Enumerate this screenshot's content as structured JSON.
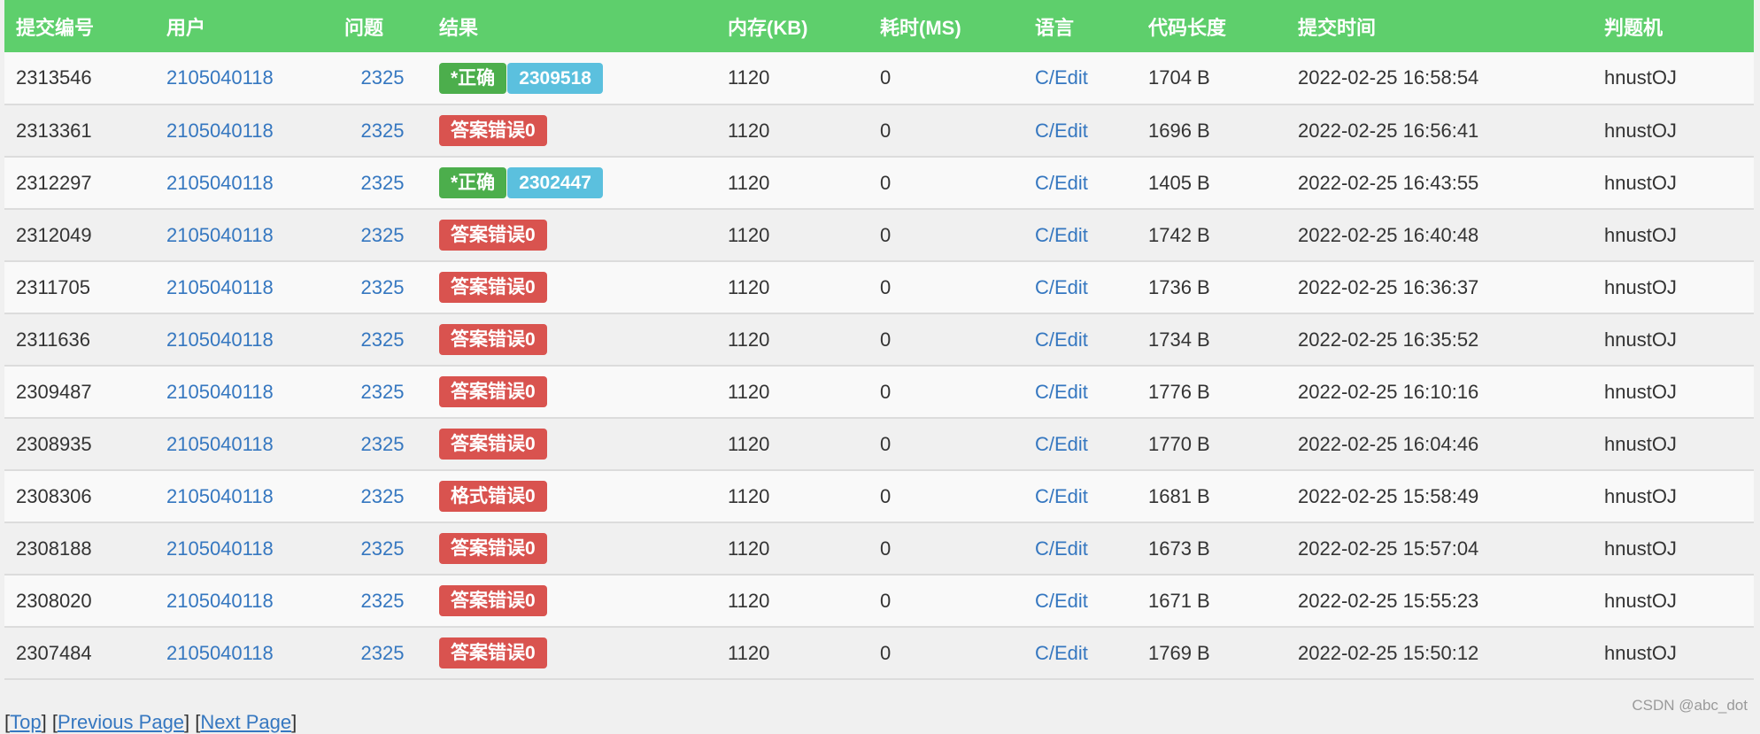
{
  "headers": [
    "提交编号",
    "用户",
    "问题",
    "结果",
    "内存(KB)",
    "耗时(MS)",
    "语言",
    "代码长度",
    "提交时间",
    "判题机"
  ],
  "rows": [
    {
      "id": "2313546",
      "user": "2105040118",
      "problem": "2325",
      "result": "*正确",
      "result_type": "accepted",
      "sim": "2309518",
      "memory": "1120",
      "time": "0",
      "lang": "C/Edit",
      "length": "1704 B",
      "submitted": "2022-02-25 16:58:54",
      "judge": "hnustOJ"
    },
    {
      "id": "2313361",
      "user": "2105040118",
      "problem": "2325",
      "result": "答案错误0",
      "result_type": "wrong",
      "sim": "",
      "memory": "1120",
      "time": "0",
      "lang": "C/Edit",
      "length": "1696 B",
      "submitted": "2022-02-25 16:56:41",
      "judge": "hnustOJ"
    },
    {
      "id": "2312297",
      "user": "2105040118",
      "problem": "2325",
      "result": "*正确",
      "result_type": "accepted",
      "sim": "2302447",
      "memory": "1120",
      "time": "0",
      "lang": "C/Edit",
      "length": "1405 B",
      "submitted": "2022-02-25 16:43:55",
      "judge": "hnustOJ"
    },
    {
      "id": "2312049",
      "user": "2105040118",
      "problem": "2325",
      "result": "答案错误0",
      "result_type": "wrong",
      "sim": "",
      "memory": "1120",
      "time": "0",
      "lang": "C/Edit",
      "length": "1742 B",
      "submitted": "2022-02-25 16:40:48",
      "judge": "hnustOJ"
    },
    {
      "id": "2311705",
      "user": "2105040118",
      "problem": "2325",
      "result": "答案错误0",
      "result_type": "wrong",
      "sim": "",
      "memory": "1120",
      "time": "0",
      "lang": "C/Edit",
      "length": "1736 B",
      "submitted": "2022-02-25 16:36:37",
      "judge": "hnustOJ"
    },
    {
      "id": "2311636",
      "user": "2105040118",
      "problem": "2325",
      "result": "答案错误0",
      "result_type": "wrong",
      "sim": "",
      "memory": "1120",
      "time": "0",
      "lang": "C/Edit",
      "length": "1734 B",
      "submitted": "2022-02-25 16:35:52",
      "judge": "hnustOJ"
    },
    {
      "id": "2309487",
      "user": "2105040118",
      "problem": "2325",
      "result": "答案错误0",
      "result_type": "wrong",
      "sim": "",
      "memory": "1120",
      "time": "0",
      "lang": "C/Edit",
      "length": "1776 B",
      "submitted": "2022-02-25 16:10:16",
      "judge": "hnustOJ"
    },
    {
      "id": "2308935",
      "user": "2105040118",
      "problem": "2325",
      "result": "答案错误0",
      "result_type": "wrong",
      "sim": "",
      "memory": "1120",
      "time": "0",
      "lang": "C/Edit",
      "length": "1770 B",
      "submitted": "2022-02-25 16:04:46",
      "judge": "hnustOJ"
    },
    {
      "id": "2308306",
      "user": "2105040118",
      "problem": "2325",
      "result": "格式错误0",
      "result_type": "wrong",
      "sim": "",
      "memory": "1120",
      "time": "0",
      "lang": "C/Edit",
      "length": "1681 B",
      "submitted": "2022-02-25 15:58:49",
      "judge": "hnustOJ"
    },
    {
      "id": "2308188",
      "user": "2105040118",
      "problem": "2325",
      "result": "答案错误0",
      "result_type": "wrong",
      "sim": "",
      "memory": "1120",
      "time": "0",
      "lang": "C/Edit",
      "length": "1673 B",
      "submitted": "2022-02-25 15:57:04",
      "judge": "hnustOJ"
    },
    {
      "id": "2308020",
      "user": "2105040118",
      "problem": "2325",
      "result": "答案错误0",
      "result_type": "wrong",
      "sim": "",
      "memory": "1120",
      "time": "0",
      "lang": "C/Edit",
      "length": "1671 B",
      "submitted": "2022-02-25 15:55:23",
      "judge": "hnustOJ"
    },
    {
      "id": "2307484",
      "user": "2105040118",
      "problem": "2325",
      "result": "答案错误0",
      "result_type": "wrong",
      "sim": "",
      "memory": "1120",
      "time": "0",
      "lang": "C/Edit",
      "length": "1769 B",
      "submitted": "2022-02-25 15:50:12",
      "judge": "hnustOJ"
    }
  ],
  "nav": {
    "top": "Top",
    "previous": "Previous Page",
    "next": "Next Page"
  },
  "watermark": "CSDN @abc_dot",
  "colors": {
    "header": "#5ecf6c",
    "accepted": "#4cae4c",
    "sim": "#5bc0de",
    "wrong": "#d9534f",
    "link": "#3577c0"
  }
}
